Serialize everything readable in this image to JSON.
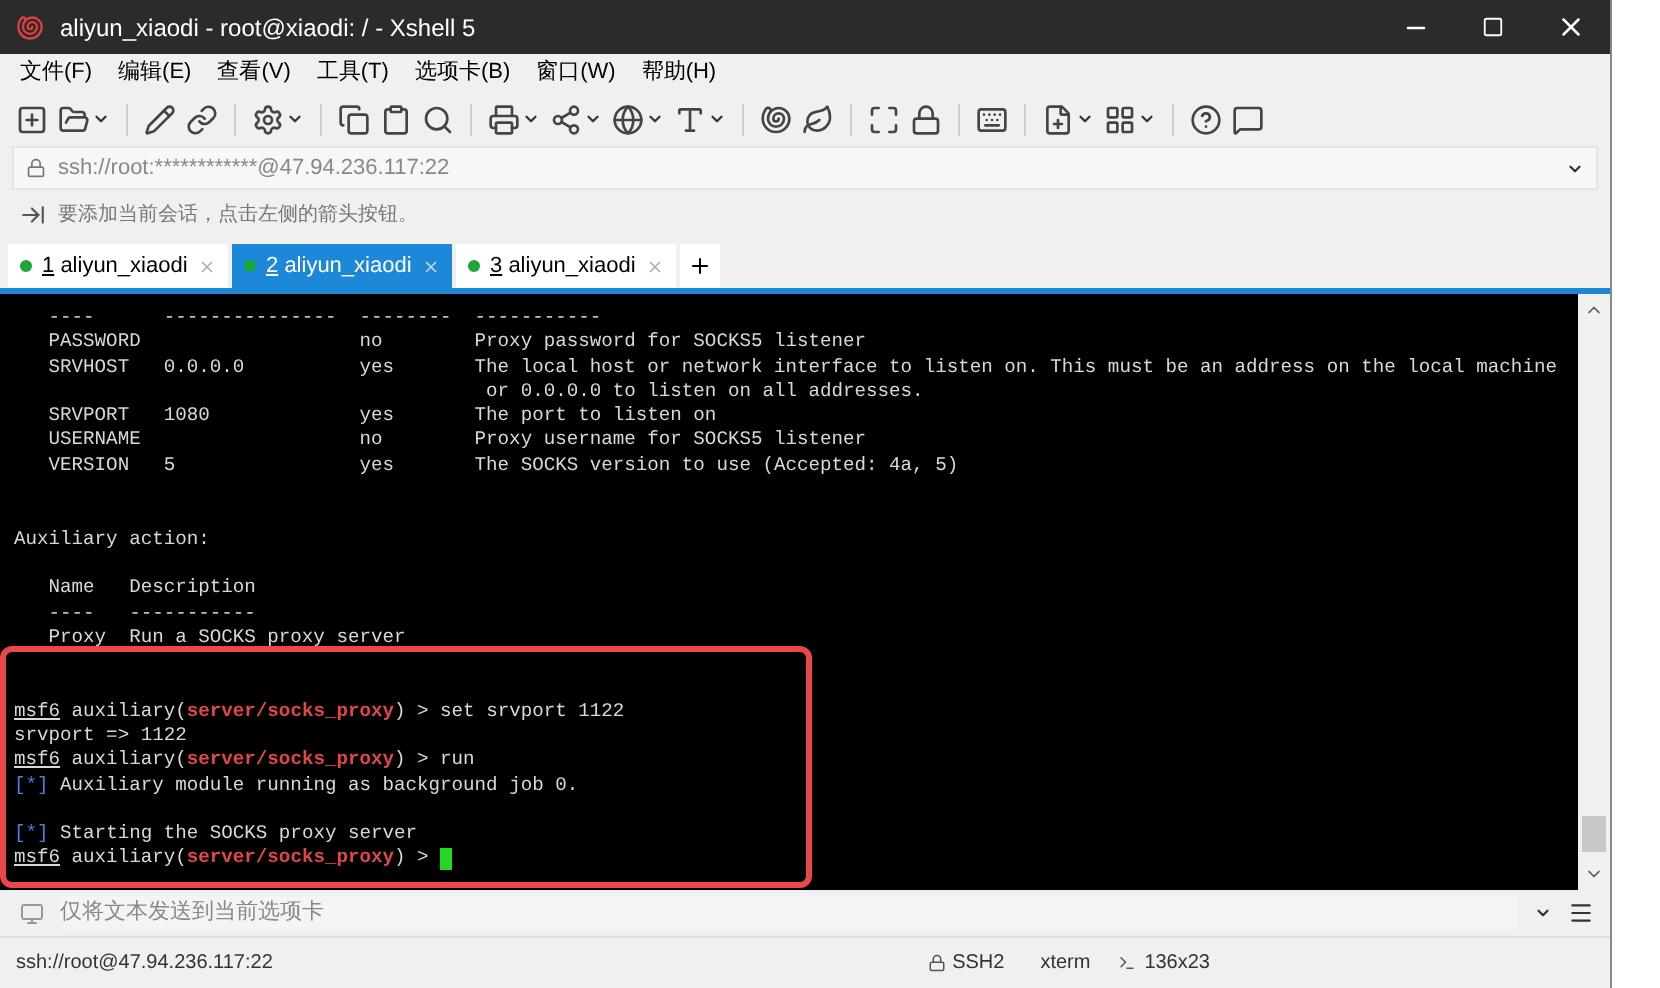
{
  "window": {
    "title": "aliyun_xiaodi - root@xiaodi: / - Xshell 5"
  },
  "menu": [
    "文件(F)",
    "编辑(E)",
    "查看(V)",
    "工具(T)",
    "选项卡(B)",
    "窗口(W)",
    "帮助(H)"
  ],
  "address_bar": {
    "value": "ssh://root:************@47.94.236.117:22"
  },
  "hint": "要添加当前会话，点击左侧的箭头按钮。",
  "tabs": [
    {
      "number": "1",
      "label": "aliyun_xiaodi",
      "selected": false
    },
    {
      "number": "2",
      "label": "aliyun_xiaodi",
      "selected": true
    },
    {
      "number": "3",
      "label": "aliyun_xiaodi",
      "selected": false
    }
  ],
  "terminal": {
    "lines": [
      {
        "kind": "text",
        "parts": [
          {
            "kind": "plain",
            "text": "   ----      ---------------  --------  -----------"
          }
        ]
      },
      {
        "kind": "text",
        "parts": [
          {
            "kind": "plain",
            "text": "   PASSWORD                   no        Proxy password for SOCKS5 listener"
          }
        ]
      },
      {
        "kind": "text",
        "parts": [
          {
            "kind": "plain",
            "text": "   SRVHOST   0.0.0.0          yes       The local host or network interface to listen on. This must be an address on the local machine"
          }
        ]
      },
      {
        "kind": "text",
        "parts": [
          {
            "kind": "plain",
            "text": "                                         or 0.0.0.0 to listen on all addresses."
          }
        ]
      },
      {
        "kind": "text",
        "parts": [
          {
            "kind": "plain",
            "text": "   SRVPORT   1080             yes       The port to listen on"
          }
        ]
      },
      {
        "kind": "text",
        "parts": [
          {
            "kind": "plain",
            "text": "   USERNAME                   no        Proxy username for SOCKS5 listener"
          }
        ]
      },
      {
        "kind": "text",
        "parts": [
          {
            "kind": "plain",
            "text": "   VERSION   5                yes       The SOCKS version to use (Accepted: 4a, 5)"
          }
        ]
      },
      {
        "kind": "blank"
      },
      {
        "kind": "blank"
      },
      {
        "kind": "text",
        "parts": [
          {
            "kind": "plain",
            "text": "Auxiliary action:"
          }
        ]
      },
      {
        "kind": "blank"
      },
      {
        "kind": "text",
        "parts": [
          {
            "kind": "plain",
            "text": "   Name   Description"
          }
        ]
      },
      {
        "kind": "text",
        "parts": [
          {
            "kind": "plain",
            "text": "   ----   -----------"
          }
        ]
      },
      {
        "kind": "text",
        "parts": [
          {
            "kind": "plain",
            "text": "   Proxy  Run a SOCKS proxy server"
          }
        ]
      },
      {
        "kind": "blank"
      },
      {
        "kind": "blank"
      },
      {
        "kind": "text",
        "parts": [
          {
            "kind": "prompt",
            "text": "msf6"
          },
          {
            "kind": "plain",
            "text": " auxiliary("
          },
          {
            "kind": "module",
            "text": "server/socks_proxy"
          },
          {
            "kind": "plain",
            "text": ") > set srvport 1122"
          }
        ]
      },
      {
        "kind": "text",
        "parts": [
          {
            "kind": "plain",
            "text": "srvport => 1122"
          }
        ]
      },
      {
        "kind": "text",
        "parts": [
          {
            "kind": "prompt",
            "text": "msf6"
          },
          {
            "kind": "plain",
            "text": " auxiliary("
          },
          {
            "kind": "module",
            "text": "server/socks_proxy"
          },
          {
            "kind": "plain",
            "text": ") > run"
          }
        ]
      },
      {
        "kind": "text",
        "parts": [
          {
            "kind": "info",
            "text": "[*]"
          },
          {
            "kind": "plain",
            "text": " Auxiliary module running as background job 0."
          }
        ]
      },
      {
        "kind": "blank"
      },
      {
        "kind": "text",
        "parts": [
          {
            "kind": "info",
            "text": "[*]"
          },
          {
            "kind": "plain",
            "text": " Starting the SOCKS proxy server"
          }
        ]
      },
      {
        "kind": "cursor",
        "parts": [
          {
            "kind": "prompt",
            "text": "msf6"
          },
          {
            "kind": "plain",
            "text": " auxiliary("
          },
          {
            "kind": "module",
            "text": "server/socks_proxy"
          },
          {
            "kind": "plain",
            "text": ") > "
          }
        ]
      }
    ]
  },
  "compose": {
    "placeholder": "仅将文本发送到当前选项卡"
  },
  "status_bar": {
    "connection": "ssh://root@47.94.236.117:22",
    "protocol": "SSH2",
    "term": "xterm",
    "size": "136x23"
  }
}
